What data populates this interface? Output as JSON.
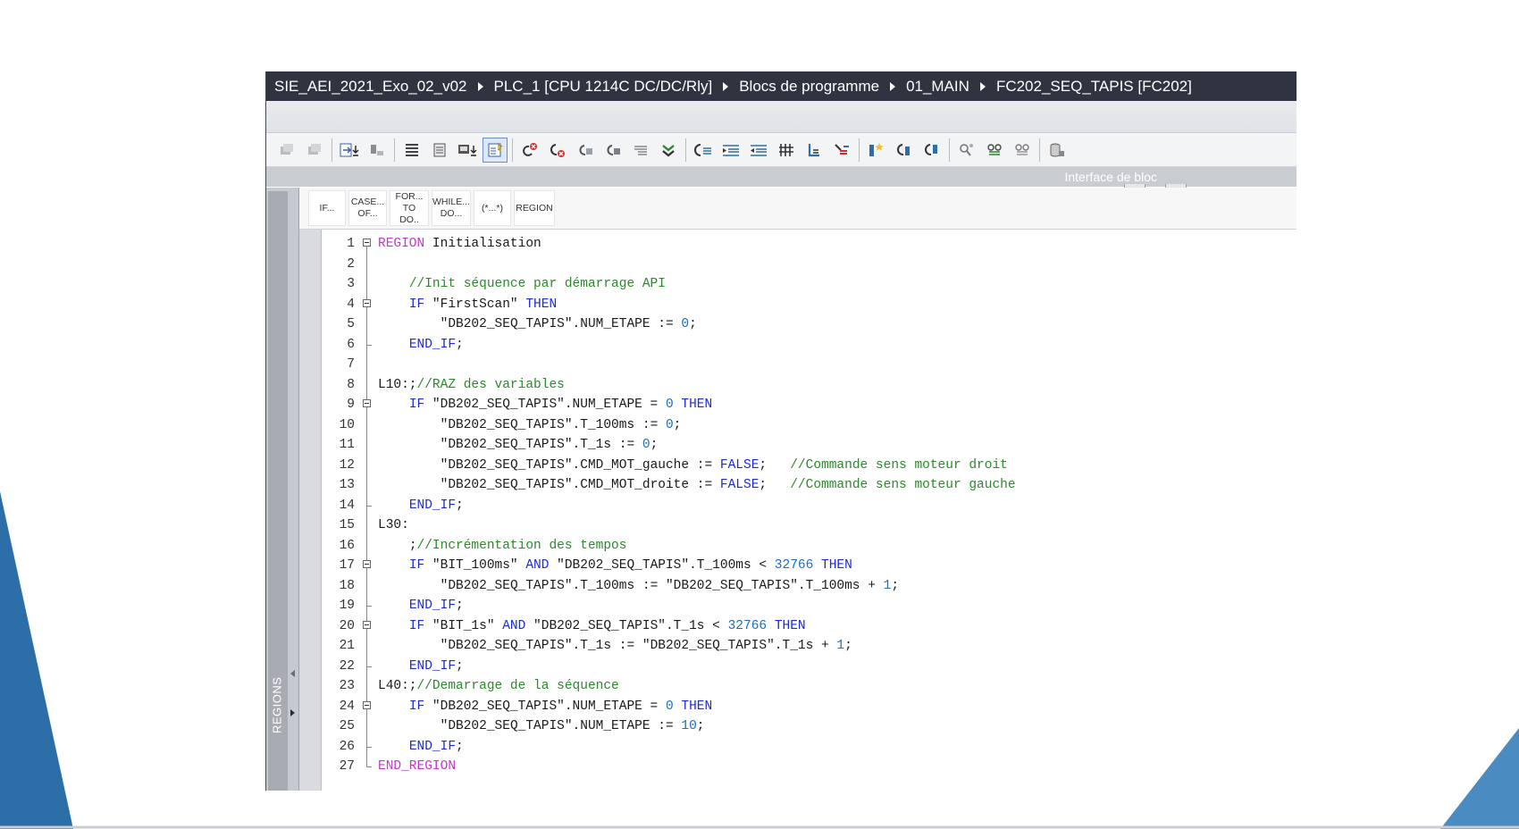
{
  "window": {
    "breadcrumb": [
      "SIE_AEI_2021_Exo_02_v02",
      "PLC_1 [CPU 1214C DC/DC/Rly]",
      "Blocs de programme",
      "01_MAIN",
      "FC202_SEQ_TAPIS [FC202]"
    ]
  },
  "toolbar": {
    "buttons": [
      "insert-network-icon",
      "delete-network-icon",
      "download-icon",
      "monitor-icon",
      "list-icon",
      "compare-icon",
      "display-icon",
      "active-highlight-icon",
      "undo-red-icon",
      "undo-cancel-icon",
      "goto-icon",
      "goto2-icon",
      "comment-icon",
      "checkmark-down-icon",
      "outdent-icon",
      "indent-right-icon",
      "indent-left-icon",
      "columns-icon",
      "bookmark-icon",
      "bookmark-next-icon",
      "star-icon",
      "jump-back-icon",
      "jump-next-icon",
      "monitor-glasses-icon",
      "watch-icon",
      "watch2-icon",
      "database-icon"
    ]
  },
  "header": {
    "interface_label": "Interface de bloc"
  },
  "regions": {
    "label": "REGIONS"
  },
  "snippets": [
    {
      "line1": "IF...",
      "line2": ""
    },
    {
      "line1": "CASE...",
      "line2": "OF..."
    },
    {
      "line1": "FOR...",
      "line2": "TO DO.."
    },
    {
      "line1": "WHILE...",
      "line2": "DO..."
    },
    {
      "line1": "(*...*)",
      "line2": ""
    },
    {
      "line1": "REGION",
      "line2": ""
    }
  ],
  "code": {
    "lines": [
      {
        "n": "1",
        "fold": "open",
        "indent": 0,
        "segs": [
          [
            "kw-region",
            "REGION"
          ],
          [
            "txt",
            " Initialisation"
          ]
        ]
      },
      {
        "n": "2",
        "fold": "line",
        "indent": 0,
        "segs": []
      },
      {
        "n": "3",
        "fold": "line",
        "indent": 1,
        "segs": [
          [
            "cm",
            "//Init séquence par démarrage API"
          ]
        ]
      },
      {
        "n": "4",
        "fold": "open",
        "indent": 1,
        "segs": [
          [
            "kw",
            "IF"
          ],
          [
            "txt",
            " \"FirstScan\" "
          ],
          [
            "kw",
            "THEN"
          ]
        ]
      },
      {
        "n": "5",
        "fold": "line",
        "indent": 2,
        "segs": [
          [
            "txt",
            "\"DB202_SEQ_TAPIS\".NUM_ETAPE := "
          ],
          [
            "num",
            "0"
          ],
          [
            "txt",
            ";"
          ]
        ]
      },
      {
        "n": "6",
        "fold": "end",
        "indent": 1,
        "segs": [
          [
            "kw",
            "END_IF"
          ],
          [
            "txt",
            ";"
          ]
        ]
      },
      {
        "n": "7",
        "fold": "line",
        "indent": 0,
        "segs": []
      },
      {
        "n": "8",
        "fold": "line",
        "indent": 0,
        "segs": [
          [
            "txt",
            "L10:;"
          ],
          [
            "cm",
            "//RAZ des variables"
          ]
        ]
      },
      {
        "n": "9",
        "fold": "open",
        "indent": 1,
        "segs": [
          [
            "kw",
            "IF"
          ],
          [
            "txt",
            " \"DB202_SEQ_TAPIS\".NUM_ETAPE = "
          ],
          [
            "num",
            "0"
          ],
          [
            "txt",
            " "
          ],
          [
            "kw",
            "THEN"
          ]
        ]
      },
      {
        "n": "10",
        "fold": "line",
        "indent": 2,
        "segs": [
          [
            "txt",
            "\"DB202_SEQ_TAPIS\".T_100ms := "
          ],
          [
            "num",
            "0"
          ],
          [
            "txt",
            ";"
          ]
        ]
      },
      {
        "n": "11",
        "fold": "line",
        "indent": 2,
        "segs": [
          [
            "txt",
            "\"DB202_SEQ_TAPIS\".T_1s := "
          ],
          [
            "num",
            "0"
          ],
          [
            "txt",
            ";"
          ]
        ]
      },
      {
        "n": "12",
        "fold": "line",
        "indent": 2,
        "segs": [
          [
            "txt",
            "\"DB202_SEQ_TAPIS\".CMD_MOT_gauche := "
          ],
          [
            "kw",
            "FALSE"
          ],
          [
            "txt",
            ";   "
          ],
          [
            "cm",
            "//Commande sens moteur droit"
          ]
        ]
      },
      {
        "n": "13",
        "fold": "line",
        "indent": 2,
        "segs": [
          [
            "txt",
            "\"DB202_SEQ_TAPIS\".CMD_MOT_droite := "
          ],
          [
            "kw",
            "FALSE"
          ],
          [
            "txt",
            ";   "
          ],
          [
            "cm",
            "//Commande sens moteur gauche"
          ]
        ]
      },
      {
        "n": "14",
        "fold": "end",
        "indent": 1,
        "segs": [
          [
            "kw",
            "END_IF"
          ],
          [
            "txt",
            ";"
          ]
        ]
      },
      {
        "n": "15",
        "fold": "line",
        "indent": 0,
        "segs": [
          [
            "txt",
            "L30:"
          ]
        ]
      },
      {
        "n": "16",
        "fold": "line",
        "indent": 1,
        "segs": [
          [
            "txt",
            ";"
          ],
          [
            "cm",
            "//Incrémentation des tempos"
          ]
        ]
      },
      {
        "n": "17",
        "fold": "open",
        "indent": 1,
        "segs": [
          [
            "kw",
            "IF"
          ],
          [
            "txt",
            " \"BIT_100ms\" "
          ],
          [
            "kw",
            "AND"
          ],
          [
            "txt",
            " \"DB202_SEQ_TAPIS\".T_100ms < "
          ],
          [
            "num",
            "32766"
          ],
          [
            "txt",
            " "
          ],
          [
            "kw",
            "THEN"
          ]
        ]
      },
      {
        "n": "18",
        "fold": "line",
        "indent": 2,
        "segs": [
          [
            "txt",
            "\"DB202_SEQ_TAPIS\".T_100ms := \"DB202_SEQ_TAPIS\".T_100ms + "
          ],
          [
            "num",
            "1"
          ],
          [
            "txt",
            ";"
          ]
        ]
      },
      {
        "n": "19",
        "fold": "end",
        "indent": 1,
        "segs": [
          [
            "kw",
            "END_IF"
          ],
          [
            "txt",
            ";"
          ]
        ]
      },
      {
        "n": "20",
        "fold": "open",
        "indent": 1,
        "segs": [
          [
            "kw",
            "IF"
          ],
          [
            "txt",
            " \"BIT_1s\" "
          ],
          [
            "kw",
            "AND"
          ],
          [
            "txt",
            " \"DB202_SEQ_TAPIS\".T_1s < "
          ],
          [
            "num",
            "32766"
          ],
          [
            "txt",
            " "
          ],
          [
            "kw",
            "THEN"
          ]
        ]
      },
      {
        "n": "21",
        "fold": "line",
        "indent": 2,
        "segs": [
          [
            "txt",
            "\"DB202_SEQ_TAPIS\".T_1s := \"DB202_SEQ_TAPIS\".T_1s + "
          ],
          [
            "num",
            "1"
          ],
          [
            "txt",
            ";"
          ]
        ]
      },
      {
        "n": "22",
        "fold": "end",
        "indent": 1,
        "segs": [
          [
            "kw",
            "END_IF"
          ],
          [
            "txt",
            ";"
          ]
        ]
      },
      {
        "n": "23",
        "fold": "line",
        "indent": 0,
        "segs": [
          [
            "txt",
            "L40:;"
          ],
          [
            "cm",
            "//Demarrage de la séquence"
          ]
        ]
      },
      {
        "n": "24",
        "fold": "open",
        "indent": 1,
        "segs": [
          [
            "kw",
            "IF"
          ],
          [
            "txt",
            " \"DB202_SEQ_TAPIS\".NUM_ETAPE = "
          ],
          [
            "num",
            "0"
          ],
          [
            "txt",
            " "
          ],
          [
            "kw",
            "THEN"
          ]
        ]
      },
      {
        "n": "25",
        "fold": "line",
        "indent": 2,
        "segs": [
          [
            "txt",
            "\"DB202_SEQ_TAPIS\".NUM_ETAPE := "
          ],
          [
            "num",
            "10"
          ],
          [
            "txt",
            ";"
          ]
        ]
      },
      {
        "n": "26",
        "fold": "end",
        "indent": 1,
        "segs": [
          [
            "kw",
            "END_IF"
          ],
          [
            "txt",
            ";"
          ]
        ]
      },
      {
        "n": "27",
        "fold": "endfinal",
        "indent": 0,
        "segs": [
          [
            "kw-region",
            "END_REGION"
          ]
        ]
      }
    ]
  },
  "colors": {
    "titlebar": "#2f3440",
    "accent_blue": "#2c6fa8",
    "keyword": "#1c2bd6",
    "region_keyword": "#c238c8",
    "comment": "#2a8a2a",
    "number": "#1b6fc4"
  }
}
